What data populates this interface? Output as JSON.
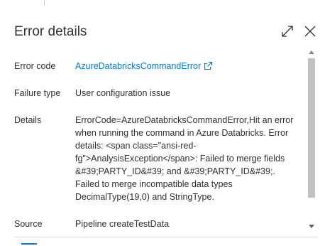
{
  "panel": {
    "title": "Error details",
    "expand_icon": "expand-diagonal-icon",
    "close_icon": "close-icon"
  },
  "fields": {
    "error_code": {
      "label": "Error code",
      "value": "AzureDatabricksCommandError",
      "icon": "external-link-icon"
    },
    "failure_type": {
      "label": "Failure type",
      "value": "User configuration issue"
    },
    "details": {
      "label": "Details",
      "value": "ErrorCode=AzureDatabricksCommandError,Hit an error when running the command in Azure Databricks. Error details: <span class=\"ansi-red-fg\">AnalysisException</span>: Failed to merge fields &#39;PARTY_ID&#39; and &#39;PARTY_ID&#39;. Failed to merge incompatible data types DecimalType(19,0) and StringType."
    },
    "source": {
      "label": "Source",
      "value": "Pipeline createTestData"
    }
  },
  "colors": {
    "link": "#0078d4",
    "text": "#323130",
    "scroll_thumb": "#c2c2c2"
  }
}
